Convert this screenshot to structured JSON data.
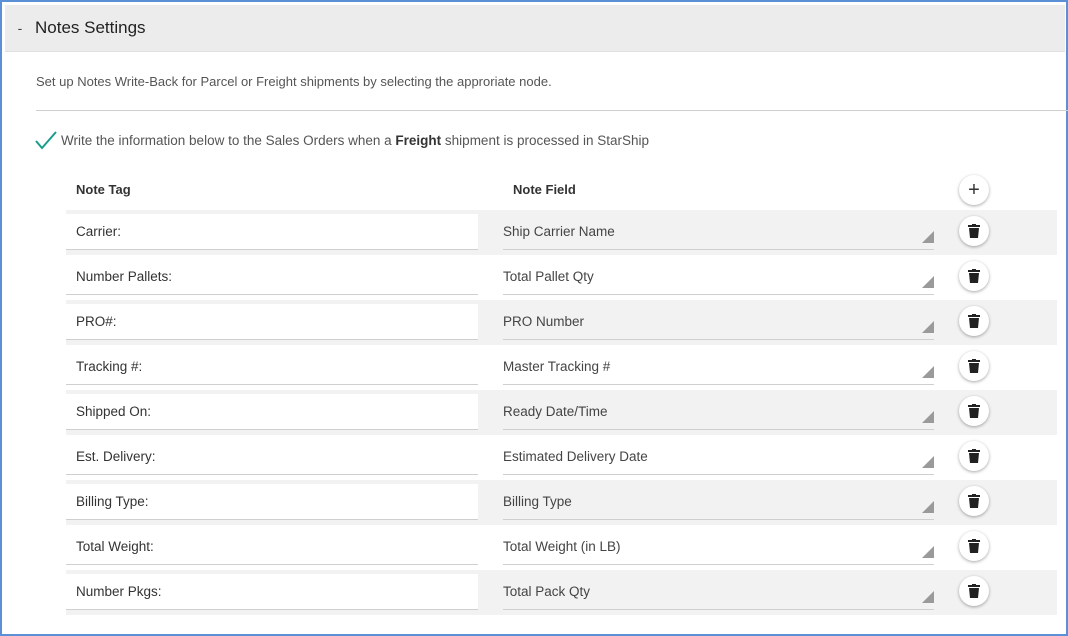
{
  "panel": {
    "collapse_symbol": "-",
    "title": "Notes Settings",
    "description": "Set up Notes Write-Back for Parcel or Freight shipments by selecting the approriate node."
  },
  "writeback": {
    "checked": true,
    "text_before": "Write the information below to the Sales Orders when a ",
    "text_bold": "Freight",
    "text_after": " shipment is processed in StarShip"
  },
  "table": {
    "col_note_tag": "Note Tag",
    "col_note_field": "Note Field",
    "add_symbol": "+",
    "rows": [
      {
        "tag": "Carrier:",
        "field": "Ship Carrier Name"
      },
      {
        "tag": "Number Pallets:",
        "field": "Total Pallet Qty"
      },
      {
        "tag": "PRO#:",
        "field": "PRO Number"
      },
      {
        "tag": "Tracking #:",
        "field": "Master Tracking #"
      },
      {
        "tag": "Shipped On:",
        "field": "Ready Date/Time"
      },
      {
        "tag": "Est. Delivery:",
        "field": "Estimated Delivery Date"
      },
      {
        "tag": "Billing Type:",
        "field": "Billing Type"
      },
      {
        "tag": "Total Weight:",
        "field": "Total Weight (in LB)"
      },
      {
        "tag": "Number Pkgs:",
        "field": "Total Pack Qty"
      }
    ]
  },
  "icons": {
    "collapse": "minus-icon",
    "check": "check-icon",
    "add": "plus-icon",
    "delete": "trash-icon",
    "dropdown": "dropdown-triangle-icon"
  },
  "colors": {
    "frame_border": "#5b8fd6",
    "header_bg": "#ececec",
    "check": "#1a9c8c",
    "shaded_row": "#f2f2f2"
  }
}
